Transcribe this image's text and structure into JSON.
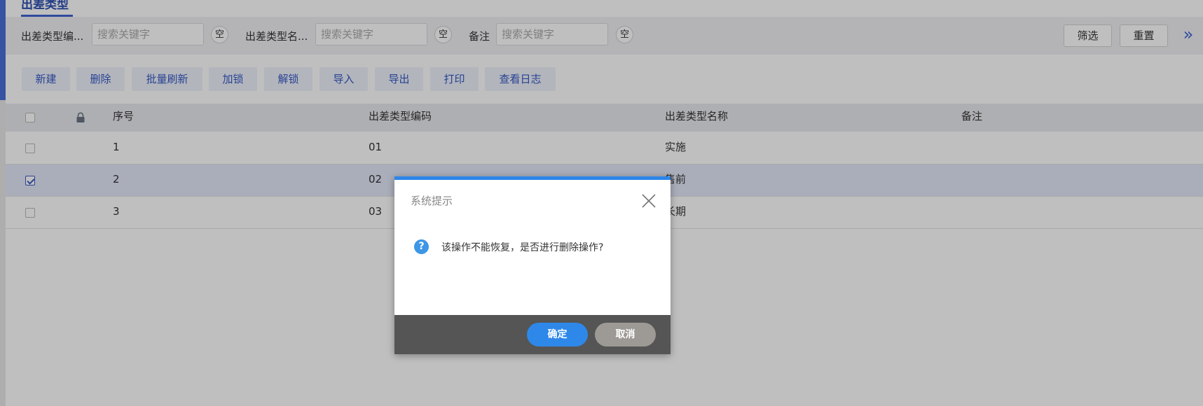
{
  "tab": {
    "title": "出差类型"
  },
  "filters": [
    {
      "label": "出差类型编...",
      "placeholder": "搜索关键字",
      "clear": "空"
    },
    {
      "label": "出差类型名...",
      "placeholder": "搜索关键字",
      "clear": "空"
    },
    {
      "label": "备注",
      "placeholder": "搜索关键字",
      "clear": "空"
    }
  ],
  "filter_actions": {
    "filter": "筛选",
    "reset": "重置",
    "expand": "»"
  },
  "toolbar": [
    "新建",
    "删除",
    "批量刷新",
    "加锁",
    "解锁",
    "导入",
    "导出",
    "打印",
    "查看日志"
  ],
  "table": {
    "columns": [
      "序号",
      "出差类型编码",
      "出差类型名称",
      "备注"
    ],
    "rows": [
      {
        "no": "1",
        "code": "01",
        "name": "实施",
        "note": "",
        "checked": false
      },
      {
        "no": "2",
        "code": "02",
        "name": "售前",
        "note": "",
        "checked": true
      },
      {
        "no": "3",
        "code": "03",
        "name": "长期",
        "note": "",
        "checked": false
      }
    ]
  },
  "dialog": {
    "title": "系统提示",
    "message": "该操作不能恢复，是否进行删除操作?",
    "icon": "question-icon",
    "ok": "确定",
    "cancel": "取消"
  },
  "colors": {
    "accent": "#3f63d2",
    "dialog_top": "#2d86e8",
    "ok": "#2e88e9",
    "cancel": "#9d9a96"
  }
}
